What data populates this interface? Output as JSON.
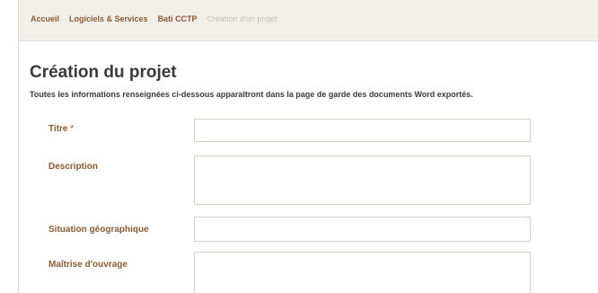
{
  "breadcrumb": {
    "items": [
      "Accueil",
      "Logiciels & Services",
      "Bati CCTP"
    ],
    "current": "Création d'un projet"
  },
  "page": {
    "title": "Création du projet",
    "intro": "Toutes les informations renseignées ci-dessous apparaîtront dans la page de garde des documents Word exportés."
  },
  "form": {
    "required_marker": "*",
    "fields": [
      {
        "label": "Titre",
        "value": ""
      },
      {
        "label": "Description",
        "value": ""
      },
      {
        "label": "Situation géographique",
        "value": ""
      },
      {
        "label": "Maîtrise d'ouvrage",
        "value": ""
      }
    ]
  },
  "colors": {
    "accent": "#8a5a33",
    "required": "#d87a3a",
    "header_bg": "#f2efea"
  }
}
